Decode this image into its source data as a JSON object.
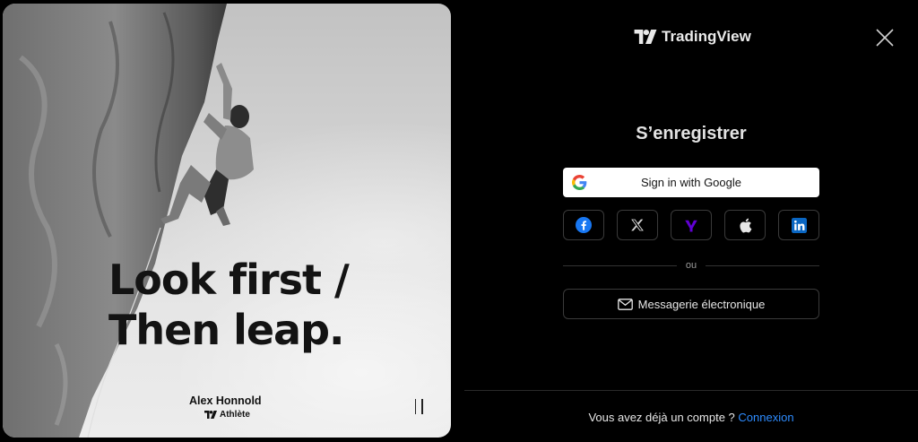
{
  "hero": {
    "headline_line1": "Look first /",
    "headline_line2": "Then leap.",
    "athlete_name": "Alex Honnold",
    "athlete_role": "Athlète"
  },
  "brand": {
    "name": "TradingView"
  },
  "auth": {
    "heading": "S’enregistrer",
    "google_label": "Sign in with Google",
    "social_icons": [
      "facebook-icon",
      "x-icon",
      "yahoo-icon",
      "apple-icon",
      "linkedin-icon"
    ],
    "divider_text": "ou",
    "email_label": "Messagerie électronique"
  },
  "footer": {
    "prompt": "Vous avez déjà un compte ?",
    "login_link": "Connexion"
  },
  "colors": {
    "background": "#000000",
    "link": "#2e8cff",
    "facebook": "#1877f2",
    "yahoo": "#6001d2",
    "linkedin": "#0a66c2"
  }
}
